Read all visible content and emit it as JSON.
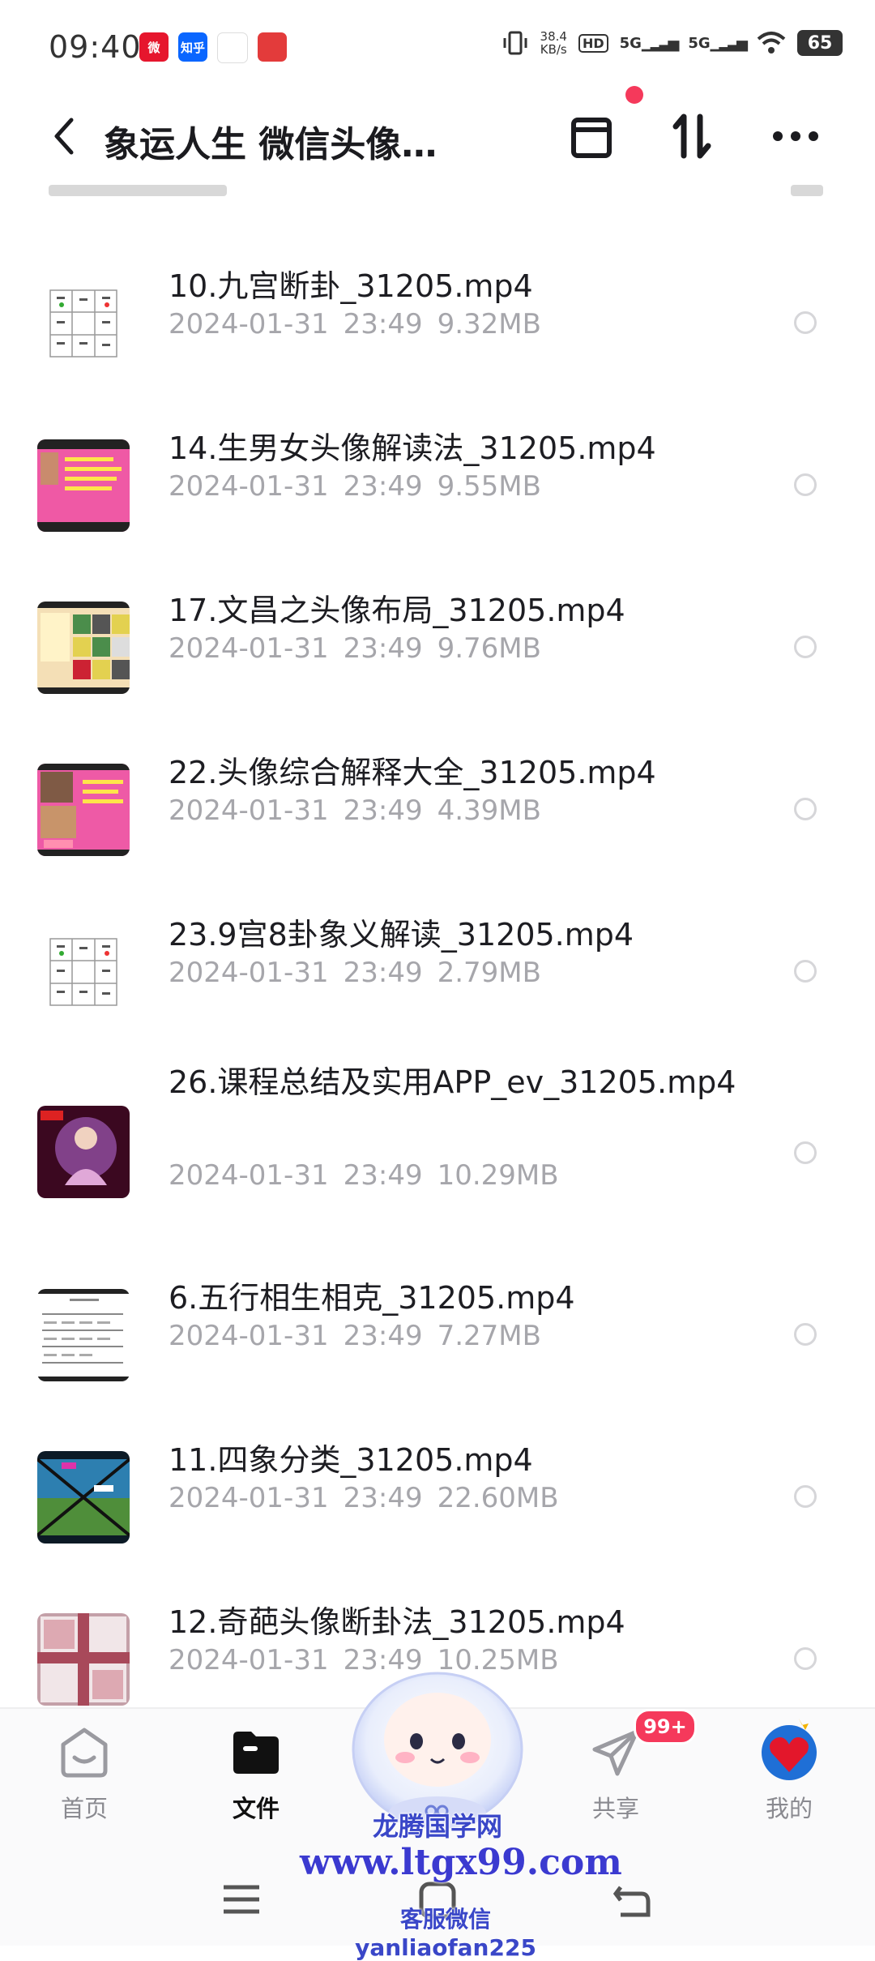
{
  "status_bar": {
    "time": "09:40",
    "net_speed_value": "38.4",
    "net_speed_unit": "KB/s",
    "hd_label": "HD",
    "sig1_label": "5G",
    "sig2_label": "5G",
    "battery": "65",
    "notifications": [
      {
        "icon": "weibo-icon",
        "label": "微",
        "color": "#e6162d"
      },
      {
        "icon": "zhihu-icon",
        "label": "知乎",
        "color": "#0a66ff"
      },
      {
        "icon": "cloud-drive-icon",
        "label": "",
        "color": "#ffffff"
      },
      {
        "icon": "app-red-icon",
        "label": "",
        "color": "#e33b3b"
      }
    ]
  },
  "header": {
    "title": "象运人生 微信头像…"
  },
  "files": [
    {
      "name": "10.九宫断卦_31205.mp4",
      "date": "2024-01-31",
      "time": "23:49",
      "size": "9.32MB",
      "thumb": "grid"
    },
    {
      "name": "14.生男女头像解读法_31205.mp4",
      "date": "2024-01-31",
      "time": "23:49",
      "size": "9.55MB",
      "thumb": "pink"
    },
    {
      "name": "17.文昌之头像布局_31205.mp4",
      "date": "2024-01-31",
      "time": "23:49",
      "size": "9.76MB",
      "thumb": "beige"
    },
    {
      "name": "22.头像综合解释大全_31205.mp4",
      "date": "2024-01-31",
      "time": "23:49",
      "size": "4.39MB",
      "thumb": "pink2"
    },
    {
      "name": "23.9宫8卦象义解读_31205.mp4",
      "date": "2024-01-31",
      "time": "23:49",
      "size": "2.79MB",
      "thumb": "grid"
    },
    {
      "name": "26.课程总结及实用APP_ev_31205.mp4",
      "date": "2024-01-31",
      "time": "23:49",
      "size": "10.29MB",
      "thumb": "dark"
    },
    {
      "name": "6.五行相生相克_31205.mp4",
      "date": "2024-01-31",
      "time": "23:49",
      "size": "7.27MB",
      "thumb": "table"
    },
    {
      "name": "11.四象分类_31205.mp4",
      "date": "2024-01-31",
      "time": "23:49",
      "size": "22.60MB",
      "thumb": "landscape"
    },
    {
      "name": "12.奇葩头像断卦法_31205.mp4",
      "date": "2024-01-31",
      "time": "23:49",
      "size": "10.25MB",
      "thumb": "mauve"
    }
  ],
  "bottom_nav": [
    {
      "label": "首页",
      "icon": "home-icon",
      "active": false
    },
    {
      "label": "文件",
      "icon": "folder-icon",
      "active": true
    },
    {
      "label": "共享",
      "icon": "share-icon",
      "active": false
    },
    {
      "label": "我的",
      "icon": "profile-icon",
      "active": false
    }
  ],
  "share_badge": "99+",
  "watermark": {
    "line1": "龙腾国学网",
    "line2": "www.ltgx99.com",
    "line3": "客服微信 yanliaofan225"
  }
}
